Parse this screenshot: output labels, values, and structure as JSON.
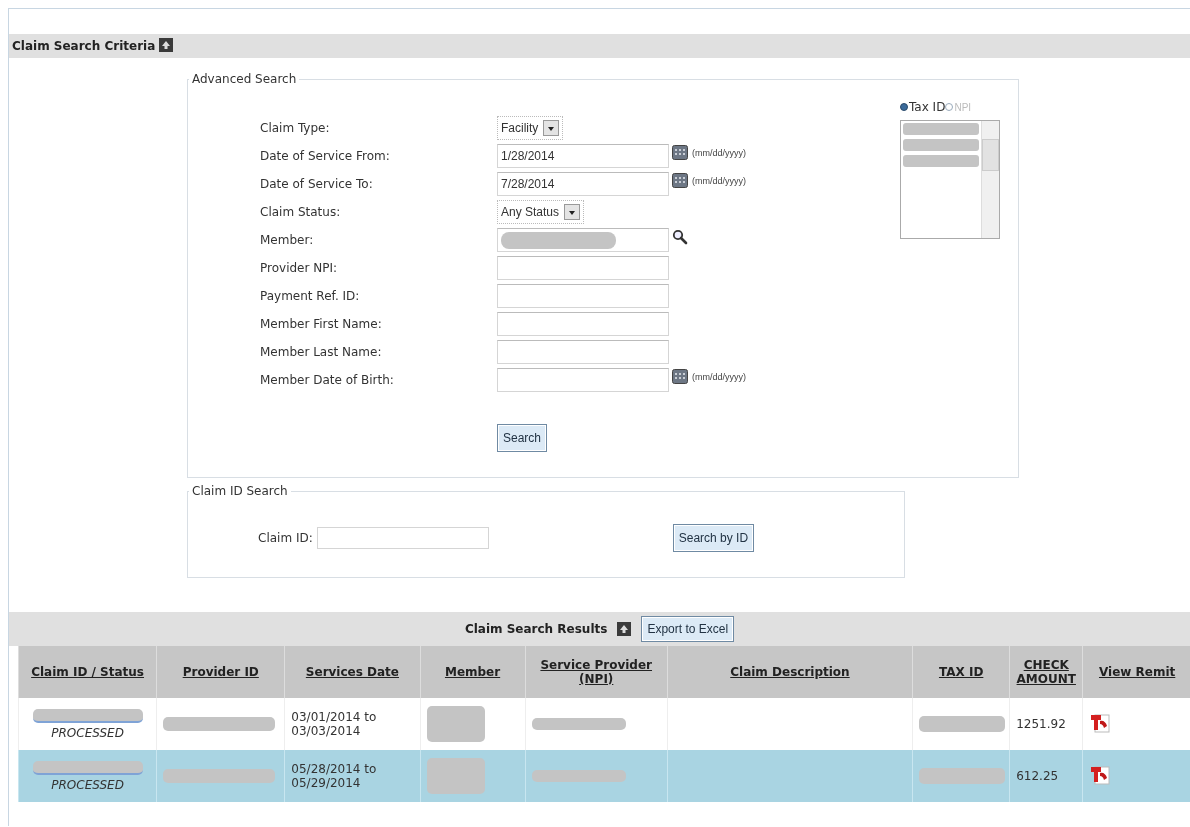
{
  "criteria_bar": {
    "title": "Claim Search Criteria"
  },
  "advanced_search": {
    "legend": "Advanced Search",
    "fields": [
      {
        "label": "Claim Type:",
        "kind": "select",
        "value": "Facility"
      },
      {
        "label": "Date of Service From:",
        "kind": "date",
        "value": "1/28/2014",
        "hint": "(mm/dd/yyyy)"
      },
      {
        "label": "Date of Service To:",
        "kind": "date",
        "value": "7/28/2014",
        "hint": "(mm/dd/yyyy)"
      },
      {
        "label": "Claim Status:",
        "kind": "select",
        "value": "Any Status"
      },
      {
        "label": "Member:",
        "kind": "lookup"
      },
      {
        "label": "Provider NPI:",
        "kind": "text"
      },
      {
        "label": "Payment Ref. ID:",
        "kind": "text"
      },
      {
        "label": "Member First Name:",
        "kind": "text"
      },
      {
        "label": "Member Last Name:",
        "kind": "text"
      },
      {
        "label": "Member Date of Birth:",
        "kind": "date",
        "hint": "(mm/dd/yyyy)"
      }
    ],
    "id_types": [
      {
        "label": "Tax ID",
        "selected": true
      },
      {
        "label": "NPI",
        "selected": false
      }
    ],
    "search_button": "Search"
  },
  "claim_id_search": {
    "legend": "Claim ID Search",
    "label": "Claim ID:",
    "button": "Search by ID"
  },
  "results": {
    "title": "Claim Search Results",
    "export_button": "Export to Excel",
    "columns": [
      "Claim ID / Status",
      "Provider ID",
      "Services Date",
      "Member",
      "Service Provider (NPI)",
      "Claim Description",
      "TAX ID",
      "CHECK AMOUNT",
      "View Remit"
    ],
    "rows": [
      {
        "status": "PROCESSED",
        "services_date": "03/01/2014 to 03/03/2014",
        "check_amount": "1251.92",
        "selected": false
      },
      {
        "status": "PROCESSED",
        "services_date": "05/28/2014 to 05/29/2014",
        "check_amount": "612.25",
        "selected": true
      }
    ]
  }
}
